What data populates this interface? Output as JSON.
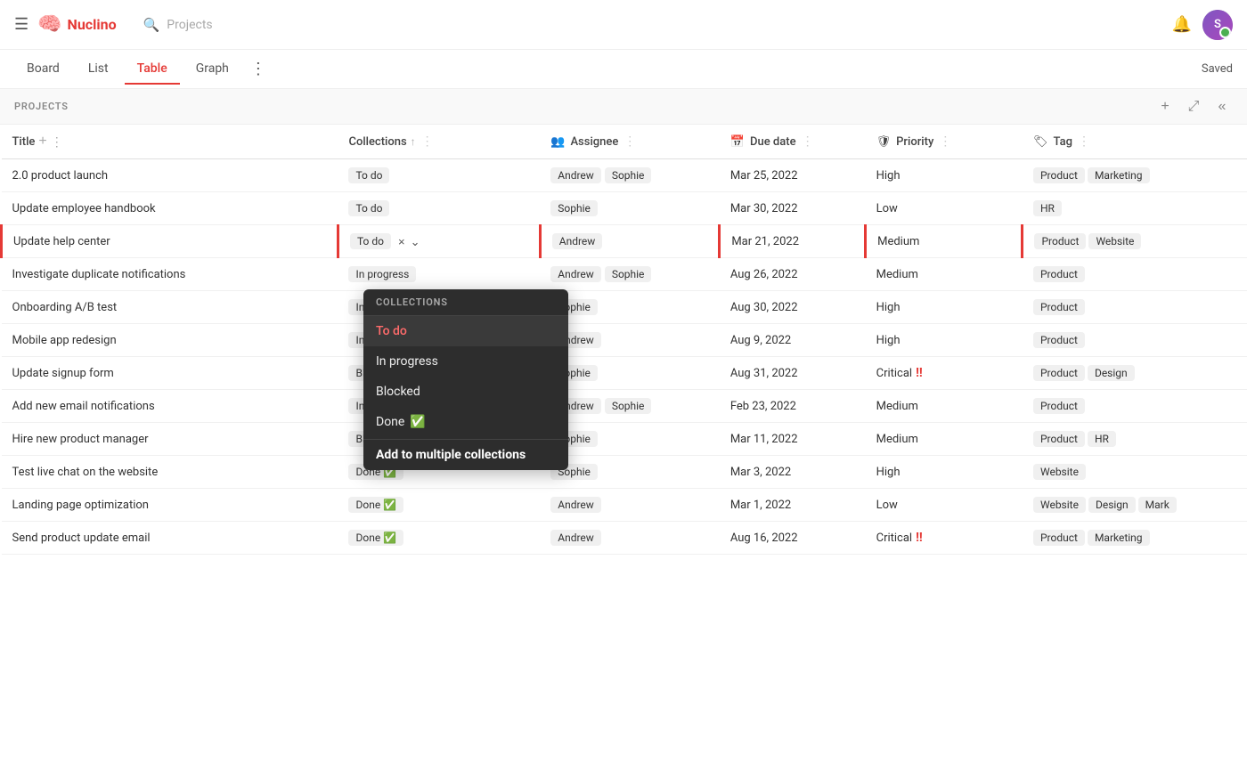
{
  "app": {
    "name": "Nuclino",
    "search_placeholder": "Projects",
    "saved_label": "Saved"
  },
  "tabs": [
    {
      "label": "Board",
      "active": false
    },
    {
      "label": "List",
      "active": false
    },
    {
      "label": "Table",
      "active": true
    },
    {
      "label": "Graph",
      "active": false
    }
  ],
  "section": {
    "title": "PROJECTS",
    "add_icon": "+",
    "collapse_icon": "⤢",
    "hide_icon": "«"
  },
  "columns": [
    {
      "label": "Title",
      "icon": "",
      "sortable": false
    },
    {
      "label": "Collections",
      "icon": "",
      "sortable": true
    },
    {
      "label": "Assignee",
      "icon": "👥",
      "sortable": false
    },
    {
      "label": "Due date",
      "icon": "📅",
      "sortable": false
    },
    {
      "label": "Priority",
      "icon": "🏷",
      "sortable": false
    },
    {
      "label": "Tag",
      "icon": "🏷",
      "sortable": false
    }
  ],
  "rows": [
    {
      "title": "2.0 product launch",
      "collection": "To do",
      "assignees": [
        "Andrew",
        "Sophie"
      ],
      "due_date": "Mar 25, 2022",
      "priority": "High",
      "tags": [
        "Product",
        "Marketing"
      ],
      "active": false
    },
    {
      "title": "Update employee handbook",
      "collection": "To do",
      "assignees": [
        "Sophie"
      ],
      "due_date": "Mar 30, 2022",
      "priority": "Low",
      "tags": [
        "HR"
      ],
      "active": false
    },
    {
      "title": "Update help center",
      "collection": "To do",
      "assignees": [
        "Andrew"
      ],
      "due_date": "Mar 21, 2022",
      "priority": "Medium",
      "tags": [
        "Product",
        "Website"
      ],
      "active": true,
      "dropdown_open": true
    },
    {
      "title": "Investigate duplicate notifications",
      "collection": "In progress",
      "assignees": [
        "Andrew",
        "Sophie"
      ],
      "due_date": "Aug 26, 2022",
      "priority": "Medium",
      "tags": [
        "Product"
      ],
      "active": false
    },
    {
      "title": "Onboarding A/B test",
      "collection": "In progress",
      "assignees": [
        "Sophie"
      ],
      "due_date": "Aug 30, 2022",
      "priority": "High",
      "tags": [
        "Product"
      ],
      "active": false
    },
    {
      "title": "Mobile app redesign",
      "collection": "In progress",
      "assignees": [
        "Andrew"
      ],
      "due_date": "Aug 9, 2022",
      "priority": "High",
      "tags": [
        "Product"
      ],
      "active": false
    },
    {
      "title": "Update signup form",
      "collection": "Blocked",
      "assignees": [
        "Sophie"
      ],
      "due_date": "Aug 31, 2022",
      "priority": "Critical",
      "priority_indicator": "‼",
      "tags": [
        "Product",
        "Design"
      ],
      "active": false
    },
    {
      "title": "Add new email notifications",
      "collection": "In progress",
      "assignees": [
        "Andrew",
        "Sophie"
      ],
      "due_date": "Feb 23, 2022",
      "priority": "Medium",
      "tags": [
        "Product"
      ],
      "active": false
    },
    {
      "title": "Hire new product manager",
      "collection": "Blocked",
      "assignees": [
        "Sophie"
      ],
      "due_date": "Mar 11, 2022",
      "priority": "Medium",
      "tags": [
        "Product",
        "HR"
      ],
      "active": false
    },
    {
      "title": "Test live chat on the website",
      "collection": "Done ✅",
      "assignees": [
        "Sophie"
      ],
      "due_date": "Mar 3, 2022",
      "priority": "High",
      "tags": [
        "Website"
      ],
      "active": false
    },
    {
      "title": "Landing page optimization",
      "collection": "Done ✅",
      "assignees": [
        "Andrew"
      ],
      "due_date": "Mar 1, 2022",
      "priority": "Low",
      "tags": [
        "Website",
        "Design",
        "Mark"
      ],
      "active": false
    },
    {
      "title": "Send product update email",
      "collection": "Done ✅",
      "assignees": [
        "Andrew"
      ],
      "due_date": "Aug 16, 2022",
      "priority": "Critical",
      "priority_indicator": "‼",
      "tags": [
        "Product",
        "Marketing"
      ],
      "active": false
    }
  ],
  "dropdown": {
    "header": "COLLECTIONS",
    "items": [
      {
        "label": "To do",
        "selected": true
      },
      {
        "label": "In progress",
        "selected": false
      },
      {
        "label": "Blocked",
        "selected": false
      },
      {
        "label": "Done ✅",
        "selected": false
      }
    ],
    "add_multiple_label": "Add to multiple collections"
  }
}
